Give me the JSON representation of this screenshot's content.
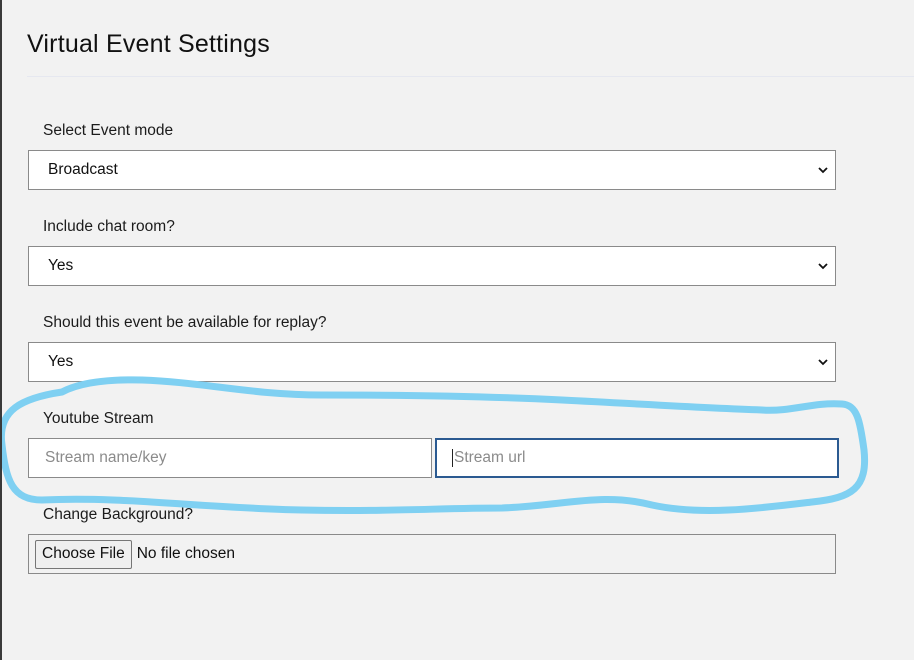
{
  "page": {
    "title": "Virtual Event Settings"
  },
  "event_mode": {
    "label": "Select Event mode",
    "value": "Broadcast"
  },
  "chat_room": {
    "label": "Include chat room?",
    "value": "Yes"
  },
  "replay": {
    "label": "Should this event be available for replay?",
    "value": "Yes"
  },
  "youtube": {
    "label": "Youtube Stream",
    "name_placeholder": "Stream name/key",
    "url_placeholder": "Stream url"
  },
  "background": {
    "label": "Change Background?",
    "button_label": "Choose File",
    "status": "No file chosen"
  },
  "colors": {
    "page_bg": "#f2f2f2",
    "focus_border": "#2b5a91",
    "annotation_stroke": "#7fd0f2"
  }
}
